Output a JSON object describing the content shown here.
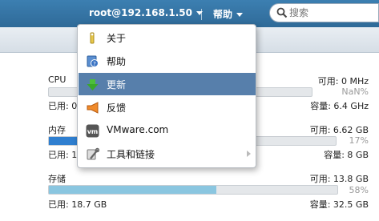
{
  "topbar": {
    "user_label": "root@192.168.1.50",
    "help_label": "帮助",
    "search_placeholder": "搜索"
  },
  "help_menu": {
    "items": [
      {
        "label": "关于",
        "icon": "about-icon"
      },
      {
        "label": "帮助",
        "icon": "help-book-icon"
      },
      {
        "label": "更新",
        "icon": "download-arrow-icon",
        "active": true
      },
      {
        "label": "反馈",
        "icon": "megaphone-icon"
      },
      {
        "label": "VMware.com",
        "icon": "vm-logo-icon"
      },
      {
        "label": "工具和链接",
        "icon": "tools-icon",
        "has_submenu": true
      }
    ]
  },
  "resources": {
    "cpu": {
      "name": "CPU",
      "free": "可用: 0 MHz",
      "percent": "NaN%",
      "used": "已用: 0",
      "capacity": "容量: 6.4 GHz",
      "fill_fraction": 0,
      "color": "#4a90d9"
    },
    "memory": {
      "name": "内存",
      "free": "可用: 6.62 GB",
      "percent": "17%",
      "used": "已用: 1.",
      "capacity": "容量: 8 GB",
      "fill_fraction": 0.17,
      "color": "#2f7fd0"
    },
    "storage": {
      "name": "存储",
      "free": "可用: 13.8 GB",
      "percent": "58%",
      "used": "已用: 18.7 GB",
      "capacity": "容量: 32.5 GB",
      "fill_fraction": 0.58,
      "color": "#8ac6e0"
    }
  }
}
